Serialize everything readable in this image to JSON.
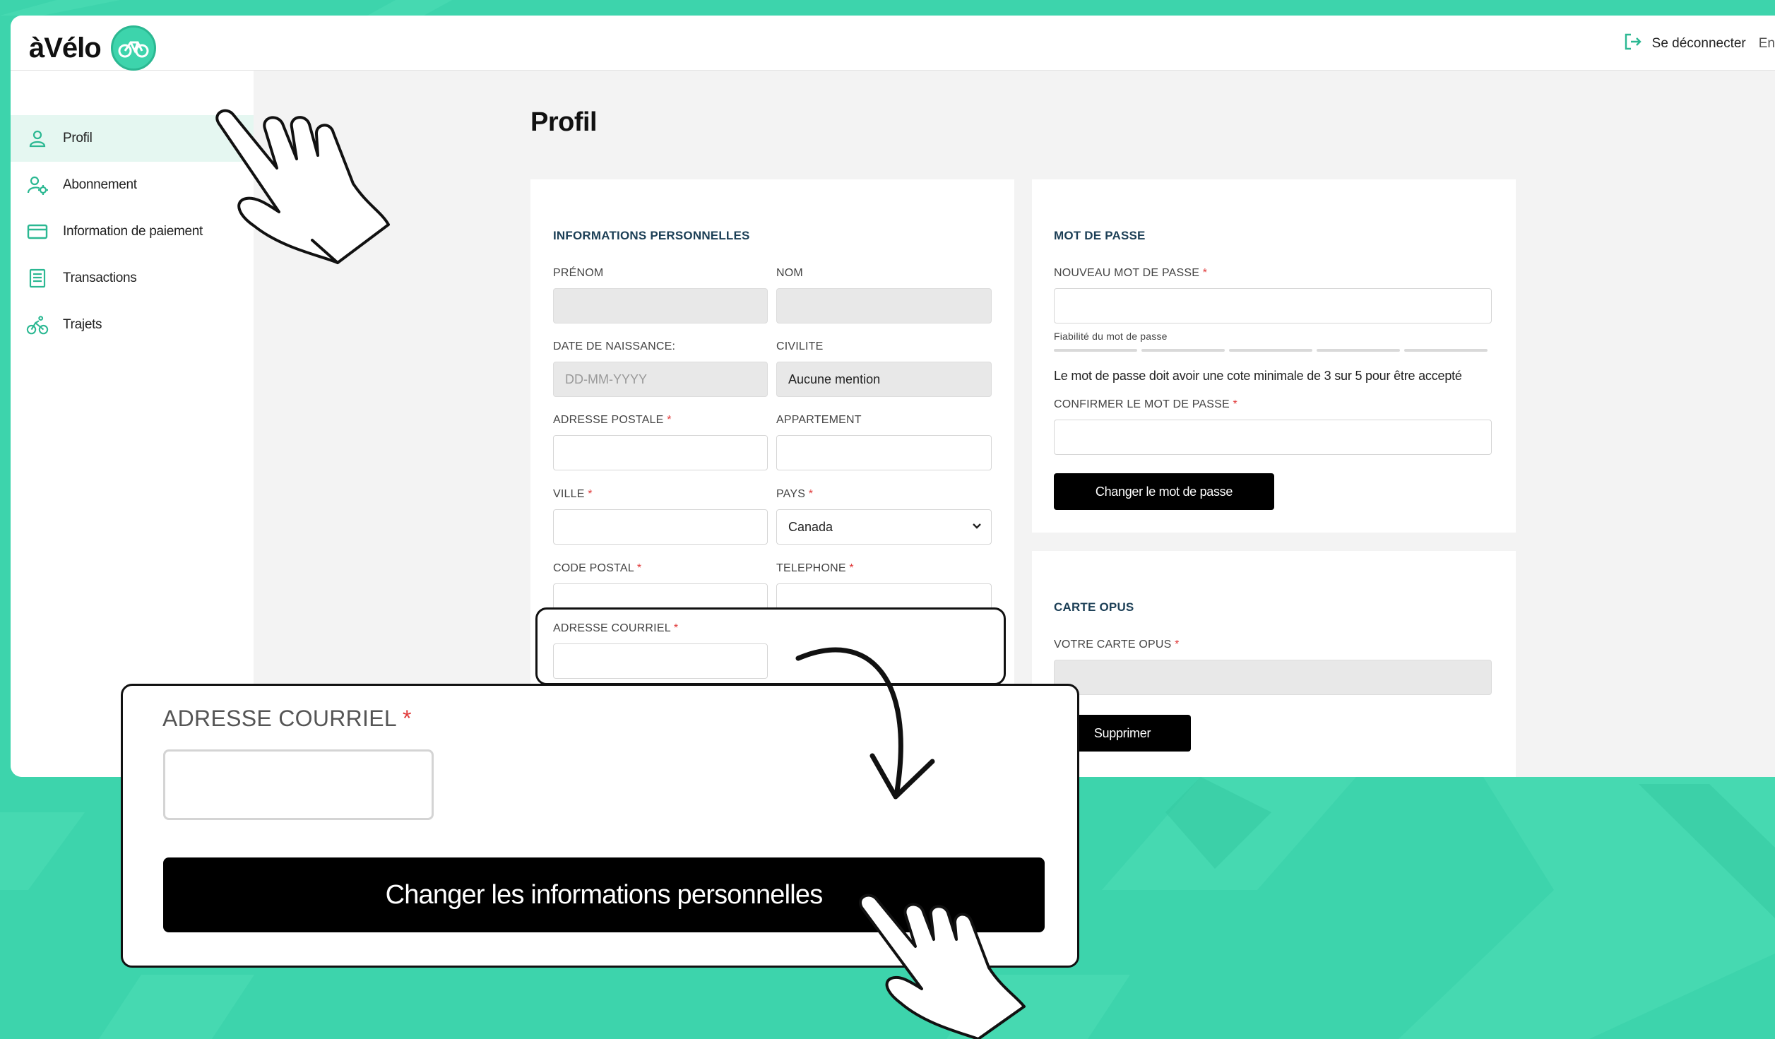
{
  "app": {
    "logo_text": "àVélo",
    "logout_label": "Se déconnecter",
    "language": "En"
  },
  "colors": {
    "accent": "#3dd4ac",
    "accent_dark": "#2bb892",
    "title_blue": "#1c3f56",
    "required": "#e03a3a",
    "button": "#000000"
  },
  "sidebar": {
    "items": [
      {
        "label": "Profil",
        "icon": "user-icon",
        "active": true
      },
      {
        "label": "Abonnement",
        "icon": "user-settings-icon",
        "active": false
      },
      {
        "label": "Information de paiement",
        "icon": "credit-card-icon",
        "active": false
      },
      {
        "label": "Transactions",
        "icon": "list-document-icon",
        "active": false
      },
      {
        "label": "Trajets",
        "icon": "cyclist-icon",
        "active": false
      }
    ]
  },
  "page": {
    "title": "Profil"
  },
  "personal": {
    "title": "INFORMATIONS PERSONNELLES",
    "firstname_label": "PRÉNOM",
    "lastname_label": "NOM",
    "birthdate_label": "DATE DE NAISSANCE:",
    "birthdate_placeholder": "DD-MM-YYYY",
    "civility_label": "CIVILITE",
    "civility_value": "Aucune mention",
    "address_label": "ADRESSE POSTALE",
    "apartment_label": "APPARTEMENT",
    "city_label": "VILLE",
    "country_label": "PAYS",
    "country_value": "Canada",
    "postal_label": "CODE POSTAL",
    "phone_label": "TELEPHONE",
    "email_label": "ADRESSE COURRIEL",
    "required_mark": "*"
  },
  "password": {
    "title": "MOT DE PASSE",
    "new_label": "NOUVEAU MOT DE PASSE",
    "strength_label": "Fiabilité du mot de passe",
    "strength_hint": "Le mot de passe doit avoir une cote minimale de 3 sur 5 pour être accepté",
    "confirm_label": "CONFIRMER LE MOT DE PASSE",
    "button_label": "Changer le mot de passe"
  },
  "opus": {
    "title": "CARTE OPUS",
    "card_label": "VOTRE CARTE OPUS",
    "button_label": "Supprimer"
  },
  "zoom": {
    "email_label": "ADRESSE COURRIEL",
    "required_mark": "*",
    "submit_label": "Changer les informations personnelles"
  }
}
